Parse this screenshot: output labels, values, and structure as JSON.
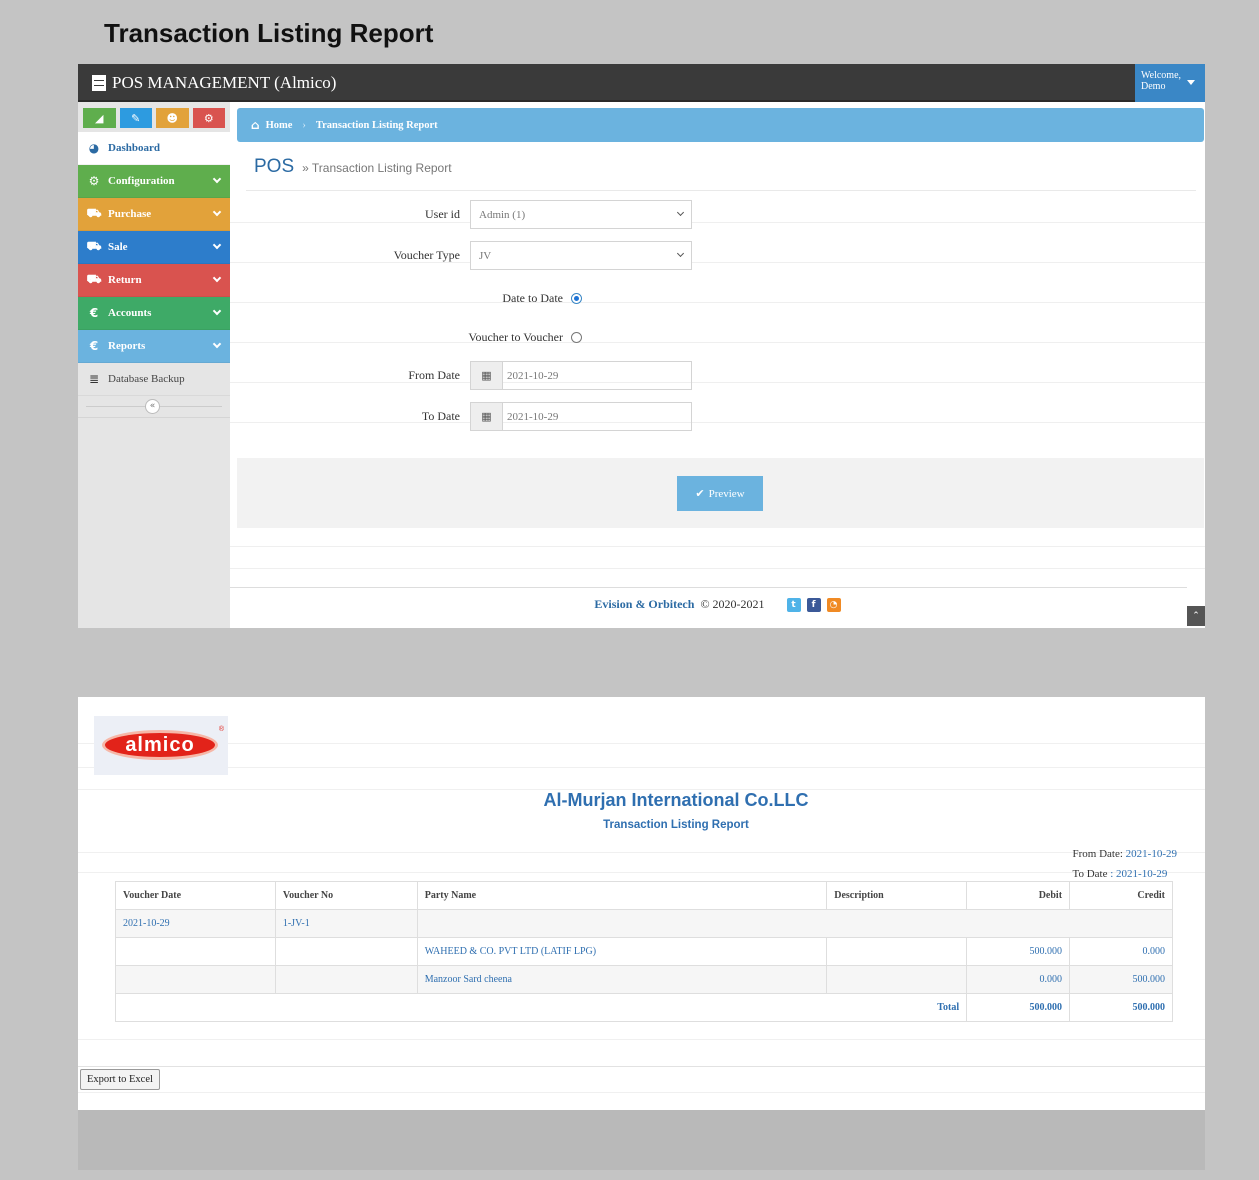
{
  "page_heading": "Transaction Listing Report",
  "app": {
    "brand": "POS MANAGEMENT (Almico)",
    "user_menu": {
      "line1": "Welcome,",
      "line2": "Demo"
    }
  },
  "sidebar": {
    "shortcuts": [
      {
        "icon": "chart-icon",
        "color": "#5fae4d"
      },
      {
        "icon": "pencil-icon",
        "color": "#2d9be0"
      },
      {
        "icon": "users-icon",
        "color": "#e2a23a"
      },
      {
        "icon": "cogs-icon",
        "color": "#d9534f"
      }
    ],
    "items": [
      {
        "label": "Dashboard",
        "icon": "dashboard-icon"
      },
      {
        "label": "Configuration",
        "icon": "cogs-icon"
      },
      {
        "label": "Purchase",
        "icon": "cart-icon"
      },
      {
        "label": "Sale",
        "icon": "cart-icon"
      },
      {
        "label": "Return",
        "icon": "cart-icon"
      },
      {
        "label": "Accounts",
        "icon": "euro-icon"
      },
      {
        "label": "Reports",
        "icon": "euro-icon"
      },
      {
        "label": "Database Backup",
        "icon": "database-icon"
      }
    ],
    "collapse_glyph": "«"
  },
  "breadcrumb": {
    "home": "Home",
    "current": "Transaction Listing Report"
  },
  "title": {
    "main": "POS",
    "sub": "» Transaction Listing Report"
  },
  "form": {
    "user_id_label": "User id",
    "user_id_value": "Admin (1)",
    "voucher_type_label": "Voucher Type",
    "voucher_type_value": "JV",
    "date_to_date_label": "Date to Date",
    "voucher_to_voucher_label": "Voucher to Voucher",
    "from_date_label": "From Date",
    "from_date_value": "2021-10-29",
    "to_date_label": "To Date",
    "to_date_value": "2021-10-29",
    "preview_label": "Preview"
  },
  "footer": {
    "company": "Evision & Orbitech",
    "copyright": "© 2020-2021"
  },
  "report": {
    "logo_text": "almico",
    "logo_reg": "®",
    "company_name": "Al-Murjan International Co.LLC",
    "title": "Transaction Listing Report",
    "from_date_label": "From Date:",
    "from_date_value": "2021-10-29",
    "to_date_label": "To Date",
    "to_date_value": ": 2021-10-29",
    "columns": [
      "Voucher Date",
      "Voucher No",
      "Party Name",
      "Description",
      "Debit",
      "Credit"
    ],
    "voucher": {
      "date": "2021-10-29",
      "no": "1-JV-1"
    },
    "rows": [
      {
        "party": "WAHEED & CO. PVT LTD (LATIF LPG)",
        "description": "",
        "debit": "500.000",
        "credit": "0.000"
      },
      {
        "party": "Manzoor Sard cheena",
        "description": "",
        "debit": "0.000",
        "credit": "500.000"
      }
    ],
    "total_label": "Total",
    "total_debit": "500.000",
    "total_credit": "500.000",
    "export_label": "Export to Excel"
  },
  "colors": {
    "topbar": "#3a3a3a",
    "accent": "#6bb3df",
    "link": "#2f6fb0"
  }
}
